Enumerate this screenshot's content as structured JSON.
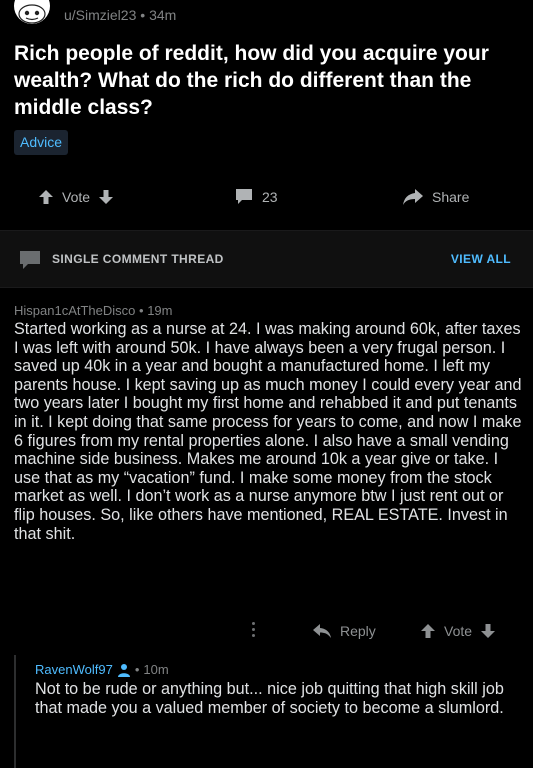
{
  "post": {
    "author": "u/Simziel23",
    "age": "34m",
    "title": "Rich people of reddit, how did you acquire your wealth? What do the rich do different than the middle class?",
    "flair": "Advice",
    "vote_label": "Vote",
    "comment_count": "23",
    "share_label": "Share"
  },
  "thread_bar": {
    "label": "SINGLE COMMENT THREAD",
    "view_all": "VIEW ALL"
  },
  "comment": {
    "author": "Hispan1cAtTheDisco",
    "age": "19m",
    "body": "Started working as a nurse at 24. I was making around 60k, after taxes I was left with around 50k. I have always been a very frugal person. I saved up 40k in a year and bought a manufactured home. I left my parents house. I kept saving up as much money I could every year and two years later I bought my first home and rehabbed it and put tenants in it. I kept doing that same process for years to come, and now I make 6 figures from my rental properties alone. I also have a small vending machine side business. Makes me around 10k a year give or take. I use that as my “vacation” fund. I make some money from the stock market as well. I don’t work as a nurse anymore btw I just rent out or flip houses. So, like others have mentioned, REAL ESTATE. Invest in that shit.",
    "reply_label": "Reply",
    "vote_label": "Vote"
  },
  "reply": {
    "author": "RavenWolf97",
    "age": "10m",
    "body": "Not to be rude or anything but... nice job quitting that high skill job that made you a valued member of society to become a slumlord."
  },
  "icons": {
    "avatar": "snoo-avatar",
    "upvote": "arrow-up-icon",
    "downvote": "arrow-down-icon",
    "comments": "comment-bubble-icon",
    "share": "share-arrow-icon",
    "thread": "chat-bubble-icon",
    "more": "kebab-menu-icon",
    "reply": "reply-arrow-icon",
    "user": "person-icon"
  },
  "colors": {
    "background": "#000000",
    "accent_blue": "#4fbcff",
    "muted_text": "#818384",
    "thread_bar_bg": "#101010"
  }
}
